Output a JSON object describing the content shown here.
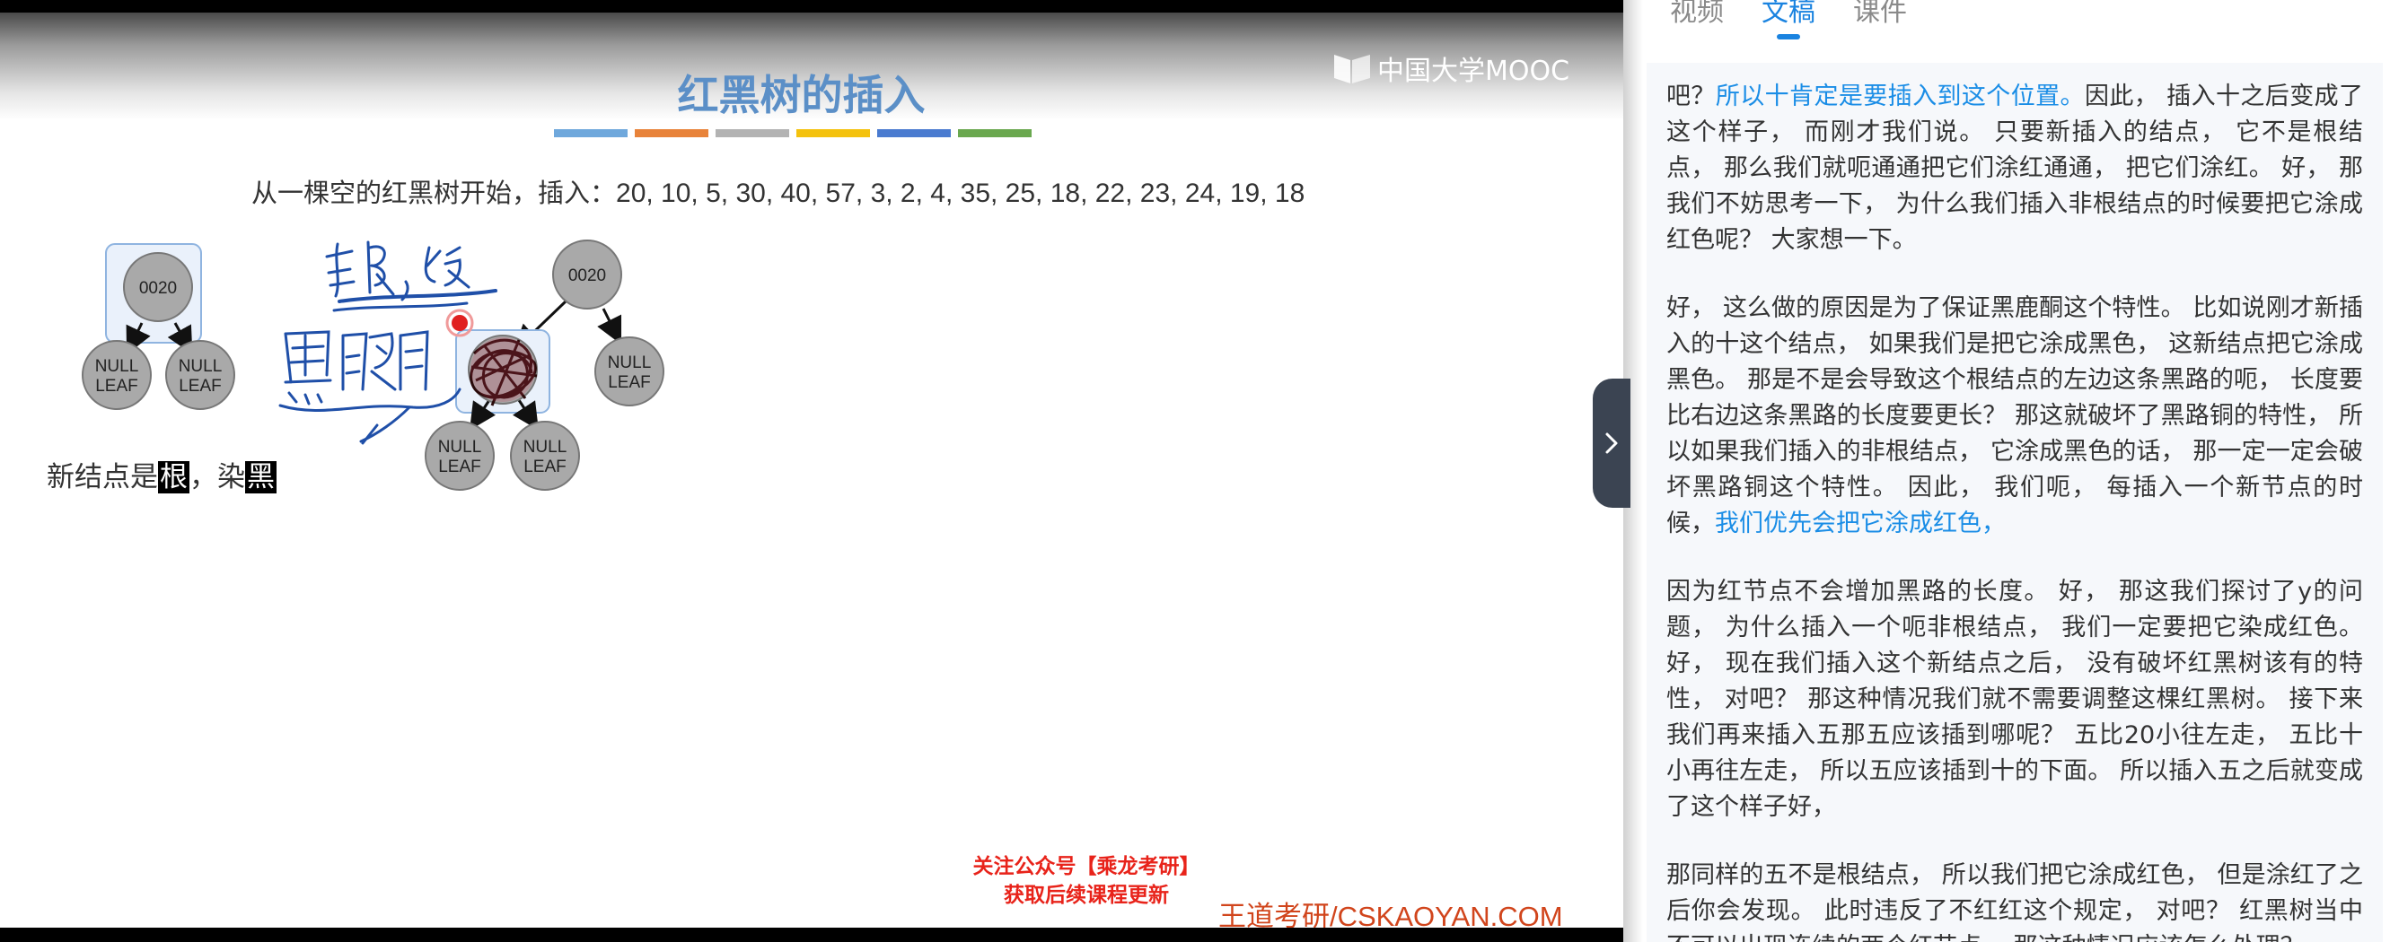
{
  "slide": {
    "logo_text": "中国大学MOOC",
    "title": "红黑树的插入",
    "color_bars": [
      "#6fa8dc",
      "#e8833a",
      "#b3b3b3",
      "#f4c20d",
      "#4a7bd0",
      "#6aa84f"
    ],
    "insert_prefix": "从一棵空的红黑树开始，插入：",
    "insert_sequence": "20, 10, 5, 30, 40, 57, 3, 2, 4, 35, 25, 18, 22, 23, 24, 19, 18",
    "tree1": {
      "root": "0020",
      "left_leaf": [
        "NULL",
        "LEAF"
      ],
      "right_leaf": [
        "NULL",
        "LEAF"
      ]
    },
    "tree2": {
      "root": "0020",
      "right_leaf": [
        "NULL",
        "LEAF"
      ],
      "child_left_leaf": [
        "NULL",
        "LEAF"
      ],
      "child_right_leaf": [
        "NULL",
        "LEAF"
      ]
    },
    "new_node_text": {
      "prefix": "新结点是",
      "root": "根",
      "middle": "，染",
      "black": "黑"
    },
    "handwriting": {
      "top": "非根，红",
      "bottom": "黑路同"
    },
    "promo_line1": "关注公众号【乘龙考研】",
    "promo_line2": "获取后续课程更新",
    "watermark": "王道考研/CSKAOYAN.COM"
  },
  "panel": {
    "tabs": [
      {
        "label": "视频",
        "active": false
      },
      {
        "label": "文稿",
        "active": true
      },
      {
        "label": "课件",
        "active": false
      }
    ],
    "paragraphs": [
      {
        "p1": "吧？",
        "blue": "所以十肯定是要插入到这个位置。",
        "p2": "因此， 插入十之后变成了这个样子， 而刚才我们说。 只要新插入的结点， 它不是根结点， 那么我们就呃通通把它们涂红通通， 把它们涂红。 好， 那我们不妨思考一下， 为什么我们插入非根结点的时候要把它涂成红色呢？ 大家想一下。"
      },
      {
        "p1": "好， 这么做的原因是为了保证黑鹿酮这个特性。 比如说刚才新插入的十这个结点， 如果我们是把它涂成黑色， 这新结点把它涂成黑色。 那是不是会导致这个根结点的左边这条黑路的呃， 长度要比右边这条黑路的长度要更长？ 那这就破坏了黑路铜的特性， 所以如果我们插入的非根结点， 它涂成黑色的话， 那一定一定会破坏黑路铜这个特性。 因此， 我们呃， 每插入一个新节点的时候，",
        "blue": "我们优先会把它涂成红色，",
        "p2": ""
      },
      {
        "p1": "因为红节点不会增加黑路的长度。 好， 那这我们探讨了y的问题， 为什么插入一个呃非根结点， 我们一定要把它染成红色。 好， 现在我们插入这个新结点之后， 没有破坏红黑树该有的特性， 对吧？ 那这种情况我们就不需要调整这棵红黑树。 接下来我们再来插入五那五应该插到哪呢？ 五比20小往左走， 五比十小再往左走， 所以五应该插到十的下面。 所以插入五之后就变成了这个样子好，",
        "blue": "",
        "p2": ""
      },
      {
        "p1": "那同样的五不是根结点， 所以我们把它涂成红色， 但是涂红了之后你会发现。 此时违反了不红红这个规定， 对吧？ 红黑树当中不可以出现连续的两个红节点。 那这种情况应该怎么处理？",
        "blue": "",
        "p2": ""
      }
    ]
  }
}
